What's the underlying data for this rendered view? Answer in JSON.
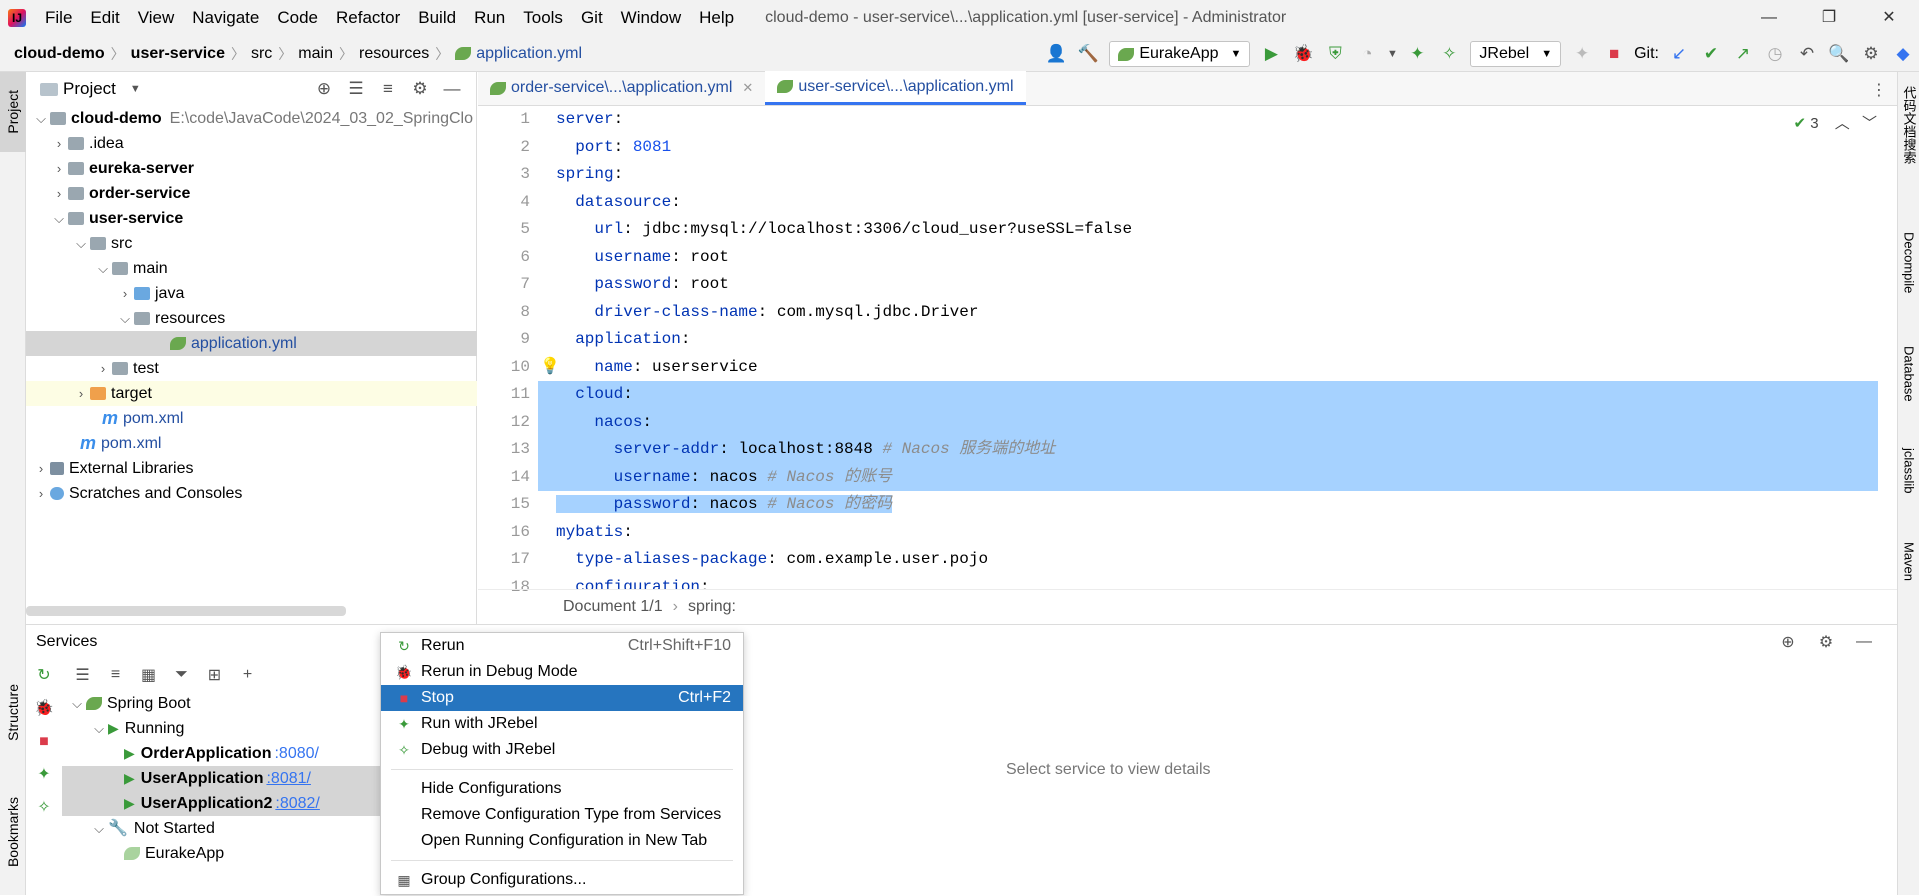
{
  "window": {
    "menu": [
      "File",
      "Edit",
      "View",
      "Navigate",
      "Code",
      "Refactor",
      "Build",
      "Run",
      "Tools",
      "Git",
      "Window",
      "Help"
    ],
    "title": "cloud-demo - user-service\\...\\application.yml [user-service] - Administrator",
    "min_glyph": "—",
    "max_glyph": "❐",
    "close_glyph": "✕"
  },
  "breadcrumbs": [
    "cloud-demo",
    "user-service",
    "src",
    "main",
    "resources",
    "application.yml"
  ],
  "toolbar": {
    "run_config": "EurakeApp",
    "jrebel": "JRebel",
    "git_label": "Git:"
  },
  "left_tabs": [
    "Project",
    "Structure",
    "Bookmarks"
  ],
  "right_tabs": [
    "代码文档搜索",
    "Decompile",
    "Database",
    "jclasslib",
    "Maven"
  ],
  "project": {
    "title": "Project",
    "tree": [
      {
        "label": "cloud-demo",
        "extra": "E:\\code\\JavaCode\\2024_03_02_SpringClo",
        "bold": true
      },
      {
        "label": ".idea"
      },
      {
        "label": "eureka-server",
        "bold": true
      },
      {
        "label": "order-service",
        "bold": true
      },
      {
        "label": "user-service",
        "bold": true
      },
      {
        "label": "src"
      },
      {
        "label": "main"
      },
      {
        "label": "java"
      },
      {
        "label": "resources"
      },
      {
        "label": "application.yml"
      },
      {
        "label": "test"
      },
      {
        "label": "target"
      },
      {
        "label": "pom.xml"
      },
      {
        "label": "pom.xml"
      },
      {
        "label": "External Libraries"
      },
      {
        "label": "Scratches and Consoles"
      }
    ]
  },
  "editor": {
    "tabs": [
      "order-service\\...\\application.yml",
      "user-service\\...\\application.yml"
    ],
    "inspection_count": "3",
    "line_numbers": [
      "1",
      "2",
      "3",
      "4",
      "5",
      "6",
      "7",
      "8",
      "9",
      "10",
      "11",
      "12",
      "13",
      "14",
      "15",
      "16",
      "17",
      "18"
    ],
    "status": "Document 1/1",
    "status_path": "spring:"
  },
  "services": {
    "title": "Services",
    "tree": [
      {
        "label": "Spring Boot"
      },
      {
        "label": "Running"
      },
      {
        "label": "OrderApplication",
        "port": ":8080/"
      },
      {
        "label": "UserApplication",
        "port": ":8081/"
      },
      {
        "label": "UserApplication2",
        "port": ":8082/"
      },
      {
        "label": "Not Started"
      },
      {
        "label": "EurakeApp"
      }
    ],
    "detail_placeholder": "Select service to view details"
  },
  "context_menu": [
    {
      "label": "Rerun",
      "shortcut": "Ctrl+Shift+F10"
    },
    {
      "label": "Rerun in Debug Mode",
      "shortcut": ""
    },
    {
      "label": "Stop",
      "shortcut": "Ctrl+F2"
    },
    {
      "label": "Run with JRebel",
      "shortcut": ""
    },
    {
      "label": "Debug with JRebel",
      "shortcut": ""
    },
    {
      "label": "Hide Configurations",
      "shortcut": ""
    },
    {
      "label": "Remove Configuration Type from Services",
      "shortcut": ""
    },
    {
      "label": "Open Running Configuration in New Tab",
      "shortcut": ""
    },
    {
      "label": "Group Configurations...",
      "shortcut": ""
    }
  ],
  "colors": {
    "selection": "#a6d2ff",
    "menu_active": "#2675bf",
    "key": "#0033b3",
    "string": "#067d17",
    "number": "#1750eb",
    "comment": "#8c8c8c"
  }
}
